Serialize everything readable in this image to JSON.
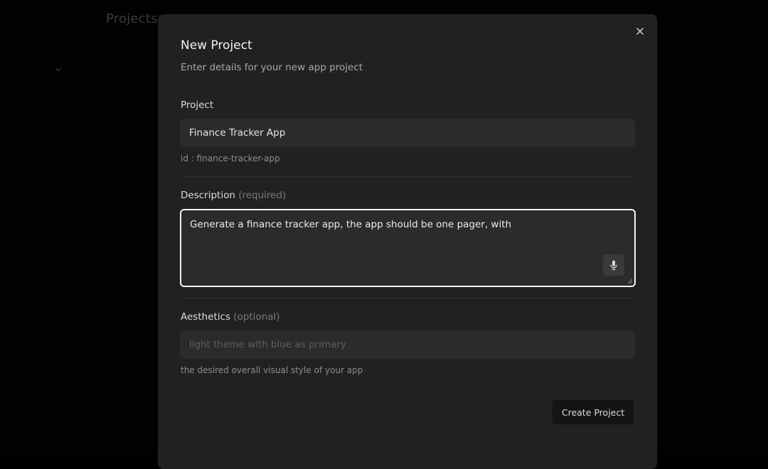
{
  "background": {
    "title": "Projects",
    "chevron_icon": "chevron-down-icon"
  },
  "modal": {
    "title": "New Project",
    "subtitle": "Enter details for your new app project",
    "close_icon": "close-icon",
    "project": {
      "label": "Project",
      "value": "Finance Tracker App",
      "helper": "id : finance-tracker-app"
    },
    "description": {
      "label": "Description",
      "qualifier": "(required)",
      "value": "Generate a finance tracker app, the app should be one pager, with",
      "mic_icon": "microphone-icon"
    },
    "aesthetics": {
      "label": "Aesthetics",
      "qualifier": "(optional)",
      "placeholder": "light theme with blue as primary",
      "helper": "the desired overall visual style of your app"
    },
    "submit_label": "Create Project"
  },
  "colors": {
    "backdrop": "#000000",
    "modal_bg": "#212121",
    "input_bg": "#2b2b2b",
    "focus_border": "#f4f4f4",
    "button_bg": "#141414"
  }
}
